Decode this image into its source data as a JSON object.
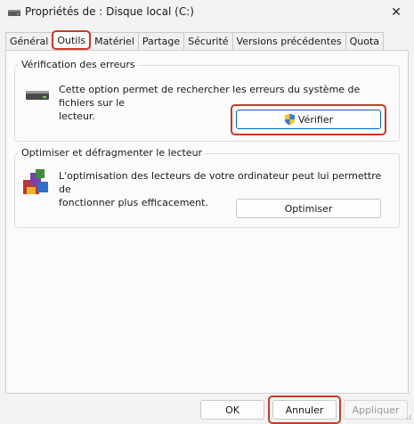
{
  "window": {
    "title": "Propriétés de : Disque local (C:)",
    "close_glyph": "✕"
  },
  "tabs": [
    {
      "label": "Général"
    },
    {
      "label": "Outils",
      "active": true
    },
    {
      "label": "Matériel"
    },
    {
      "label": "Partage"
    },
    {
      "label": "Sécurité"
    },
    {
      "label": "Versions précédentes"
    },
    {
      "label": "Quota"
    }
  ],
  "error_check": {
    "title": "Vérification des erreurs",
    "description_line1": "Cette option permet de rechercher les erreurs du système de fichiers sur le",
    "description_line2": "lecteur.",
    "button_label": "Vérifier"
  },
  "optimize": {
    "title": "Optimiser et défragmenter le lecteur",
    "description_line1": "L'optimisation des lecteurs de votre ordinateur peut lui permettre de",
    "description_line2": "fonctionner plus efficacement.",
    "button_label": "Optimiser"
  },
  "footer": {
    "ok_label": "OK",
    "cancel_label": "Annuler",
    "apply_label": "Appliquer"
  },
  "colors": {
    "highlight": "#c83a21",
    "accent": "#0067c0"
  }
}
